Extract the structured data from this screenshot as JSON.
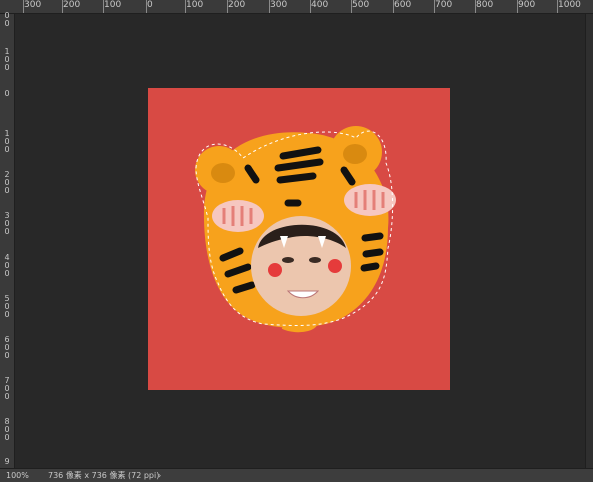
{
  "ruler_top": {
    "labels": [
      "300",
      "200",
      "100",
      "0",
      "100",
      "200",
      "300",
      "400",
      "500",
      "600",
      "700",
      "800",
      "900",
      "1000"
    ]
  },
  "ruler_left": {
    "labels": [
      "00",
      "100",
      "0",
      "100",
      "200",
      "300",
      "400",
      "500",
      "600",
      "700",
      "800",
      "9"
    ]
  },
  "status_bar": {
    "zoom": "100%",
    "doc_info": "736 像素 x 736 像素 (72 ppi)",
    "arrow": "›"
  },
  "colors": {
    "workspace": "#282828",
    "canvas": "#d84a44",
    "tiger_fur": "#f7a21c",
    "stripes": "#111111",
    "blush": "#e53b3b"
  }
}
